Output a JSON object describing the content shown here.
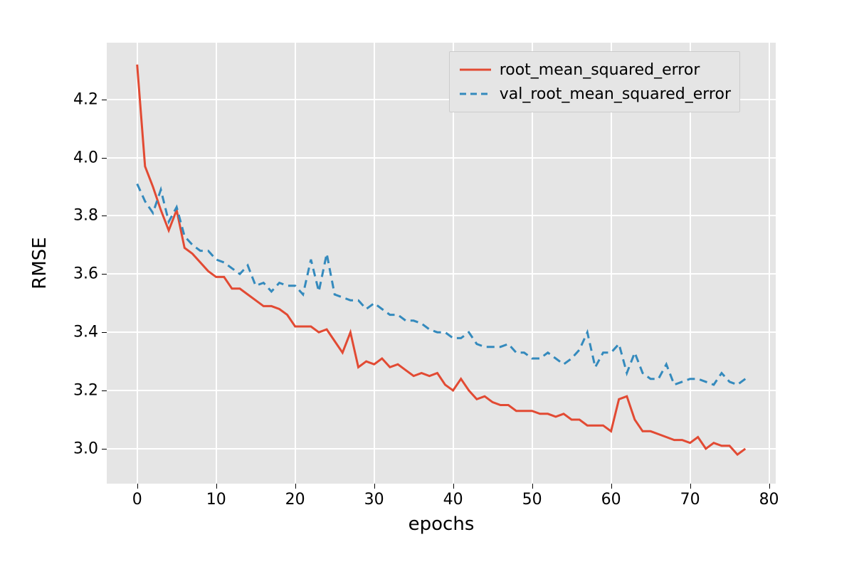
{
  "chart_data": {
    "type": "line",
    "xlabel": "epochs",
    "ylabel": "RMSE",
    "xlim": [
      -3.85,
      80.85
    ],
    "ylim": [
      2.88,
      4.395
    ],
    "xticks": [
      0,
      10,
      20,
      30,
      40,
      50,
      60,
      70,
      80
    ],
    "yticks": [
      3.0,
      3.2,
      3.4,
      3.6,
      3.8,
      4.0,
      4.2
    ],
    "x": [
      0,
      1,
      2,
      3,
      4,
      5,
      6,
      7,
      8,
      9,
      10,
      11,
      12,
      13,
      14,
      15,
      16,
      17,
      18,
      19,
      20,
      21,
      22,
      23,
      24,
      25,
      26,
      27,
      28,
      29,
      30,
      31,
      32,
      33,
      34,
      35,
      36,
      37,
      38,
      39,
      40,
      41,
      42,
      43,
      44,
      45,
      46,
      47,
      48,
      49,
      50,
      51,
      52,
      53,
      54,
      55,
      56,
      57,
      58,
      59,
      60,
      61,
      62,
      63,
      64,
      65,
      66,
      67,
      68,
      69,
      70,
      71,
      72,
      73,
      74,
      75,
      76,
      77
    ],
    "series": [
      {
        "name": "root_mean_squared_error",
        "style": "solid",
        "color": "#e24a33",
        "values": [
          4.32,
          3.97,
          3.9,
          3.82,
          3.75,
          3.82,
          3.69,
          3.67,
          3.64,
          3.61,
          3.59,
          3.59,
          3.55,
          3.55,
          3.53,
          3.51,
          3.49,
          3.49,
          3.48,
          3.46,
          3.42,
          3.42,
          3.42,
          3.4,
          3.41,
          3.37,
          3.33,
          3.4,
          3.28,
          3.3,
          3.29,
          3.31,
          3.28,
          3.29,
          3.27,
          3.25,
          3.26,
          3.25,
          3.26,
          3.22,
          3.2,
          3.24,
          3.2,
          3.17,
          3.18,
          3.16,
          3.15,
          3.15,
          3.13,
          3.13,
          3.13,
          3.12,
          3.12,
          3.11,
          3.12,
          3.1,
          3.1,
          3.08,
          3.08,
          3.08,
          3.06,
          3.17,
          3.18,
          3.1,
          3.06,
          3.06,
          3.05,
          3.04,
          3.03,
          3.03,
          3.02,
          3.04,
          3.0,
          3.02,
          3.01,
          3.01,
          2.98,
          3.0
        ]
      },
      {
        "name": "val_root_mean_squared_error",
        "style": "dashed",
        "color": "#348abd",
        "values": [
          3.91,
          3.85,
          3.81,
          3.89,
          3.78,
          3.83,
          3.73,
          3.7,
          3.68,
          3.68,
          3.65,
          3.64,
          3.62,
          3.6,
          3.63,
          3.56,
          3.57,
          3.54,
          3.57,
          3.56,
          3.56,
          3.53,
          3.65,
          3.54,
          3.67,
          3.53,
          3.52,
          3.51,
          3.51,
          3.48,
          3.5,
          3.48,
          3.46,
          3.46,
          3.44,
          3.44,
          3.43,
          3.41,
          3.4,
          3.4,
          3.38,
          3.38,
          3.4,
          3.36,
          3.35,
          3.35,
          3.35,
          3.36,
          3.33,
          3.33,
          3.31,
          3.31,
          3.33,
          3.31,
          3.29,
          3.31,
          3.34,
          3.4,
          3.28,
          3.33,
          3.33,
          3.36,
          3.26,
          3.33,
          3.26,
          3.24,
          3.24,
          3.29,
          3.22,
          3.23,
          3.24,
          3.24,
          3.23,
          3.22,
          3.26,
          3.23,
          3.22,
          3.24
        ]
      }
    ],
    "legend": {
      "position": "upper-right-inset",
      "entries": [
        "root_mean_squared_error",
        "val_root_mean_squared_error"
      ]
    }
  }
}
